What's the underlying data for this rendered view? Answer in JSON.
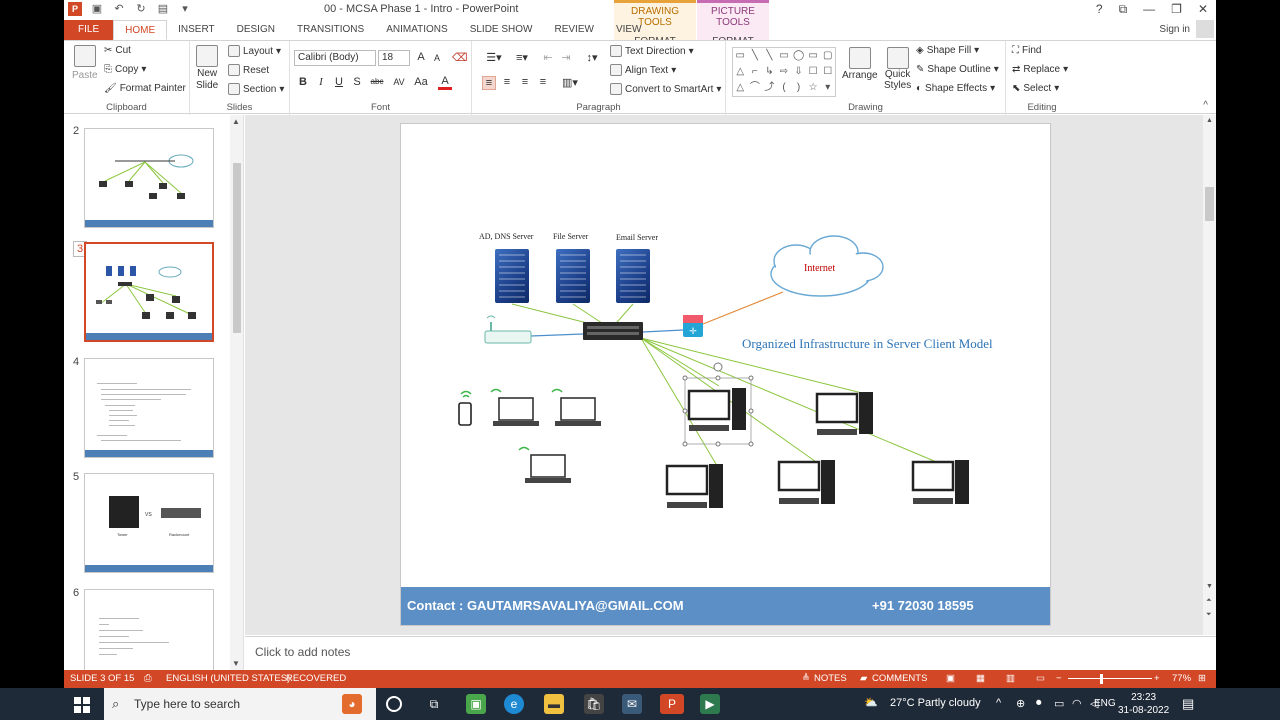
{
  "window": {
    "title": "00 - MCSA Phase 1 - Intro - PowerPoint",
    "help_icon": "?",
    "signin": "Sign in"
  },
  "context_tabs": {
    "drawing_label": "DRAWING TOOLS",
    "drawing_tab": "FORMAT",
    "picture_label": "PICTURE TOOLS",
    "picture_tab": "FORMAT"
  },
  "tabs": [
    "FILE",
    "HOME",
    "INSERT",
    "DESIGN",
    "TRANSITIONS",
    "ANIMATIONS",
    "SLIDE SHOW",
    "REVIEW",
    "VIEW"
  ],
  "ribbon": {
    "clipboard": {
      "paste": "Paste",
      "cut": "Cut",
      "copy": "Copy",
      "format_painter": "Format Painter",
      "label": "Clipboard"
    },
    "slides": {
      "new_slide_1": "New",
      "new_slide_2": "Slide",
      "layout": "Layout",
      "reset": "Reset",
      "section": "Section",
      "label": "Slides"
    },
    "font": {
      "font_name": "Calibri (Body)",
      "font_size": "18",
      "bold": "B",
      "italic": "I",
      "underline": "U",
      "strike": "S",
      "shadow": "abc",
      "spacing": "AV",
      "case": "Aa",
      "color": "A",
      "grow": "A",
      "shrink": "A",
      "label": "Font"
    },
    "paragraph": {
      "text_direction": "Text Direction",
      "align_text": "Align Text",
      "convert_smartart": "Convert to SmartArt",
      "label": "Paragraph"
    },
    "drawing": {
      "arrange": "Arrange",
      "quick_styles_1": "Quick",
      "quick_styles_2": "Styles",
      "shape_fill": "Shape Fill",
      "shape_outline": "Shape Outline",
      "shape_effects": "Shape Effects",
      "label": "Drawing"
    },
    "editing": {
      "find": "Find",
      "replace": "Replace",
      "select": "Select",
      "label": "Editing"
    }
  },
  "thumbnails": [
    {
      "num": "2"
    },
    {
      "num": "3"
    },
    {
      "num": "4"
    },
    {
      "num": "5",
      "label_left": "Tower",
      "label_vs": "VS",
      "label_right": "Rackmount"
    },
    {
      "num": "6"
    }
  ],
  "slide": {
    "servers": [
      "AD, DNS Server",
      "File Server",
      "Email Server"
    ],
    "internet": "Internet",
    "diagram_title": "Organized Infrastructure in Server Client Model",
    "footer_contact": "Contact : GAUTAMRSAVALIYA@GMAIL.COM",
    "footer_phone": "+91 72030 18595"
  },
  "notes_placeholder": "Click to add notes",
  "status": {
    "slide_of": "SLIDE 3 OF 15",
    "language": "ENGLISH (UNITED STATES)",
    "recovered": "RECOVERED",
    "notes": "NOTES",
    "comments": "COMMENTS",
    "zoom": "77%"
  },
  "taskbar": {
    "search_placeholder": "Type here to search",
    "weather": "27°C  Partly cloudy",
    "lang": "ENG",
    "time": "23:23",
    "date": "31-08-2022"
  },
  "colors": {
    "accent": "#d24726",
    "footer_bar": "#5b8fc6",
    "diagram_title": "#2e75b6",
    "link_line": "#8cc63f",
    "internet_line": "#e08a3c"
  }
}
